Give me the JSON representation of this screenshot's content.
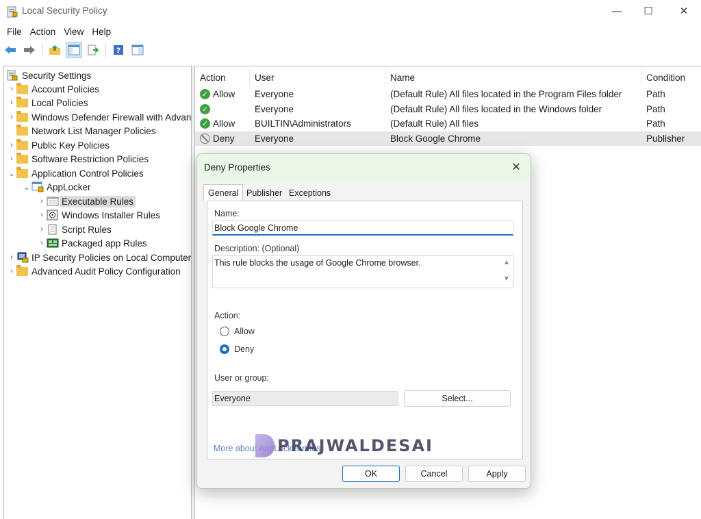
{
  "window": {
    "title": "Local Security Policy",
    "minimize": "—",
    "maximize": "☐",
    "close": "✕"
  },
  "menu": [
    "File",
    "Action",
    "View",
    "Help"
  ],
  "tree": {
    "root": "Security Settings",
    "items": [
      {
        "label": "Account Policies"
      },
      {
        "label": "Local Policies"
      },
      {
        "label": "Windows Defender Firewall with Advan"
      },
      {
        "label": "Network List Manager Policies"
      },
      {
        "label": "Public Key Policies"
      },
      {
        "label": "Software Restriction Policies"
      },
      {
        "label": "Application Control Policies"
      },
      {
        "label": "AppLocker"
      },
      {
        "label": "Executable Rules"
      },
      {
        "label": "Windows Installer Rules"
      },
      {
        "label": "Script Rules"
      },
      {
        "label": "Packaged app Rules"
      },
      {
        "label": "IP Security Policies on Local Computer"
      },
      {
        "label": "Advanced Audit Policy Configuration"
      }
    ]
  },
  "list": {
    "columns": [
      "Action",
      "User",
      "Name",
      "Condition"
    ],
    "rows": [
      {
        "action": "Allow",
        "user": "Everyone",
        "name": "(Default Rule) All files located in the Program Files folder",
        "condition": "Path"
      },
      {
        "action": "",
        "user": "Everyone",
        "name": "(Default Rule) All files located in the Windows folder",
        "condition": "Path"
      },
      {
        "action": "Allow",
        "user": "BUILTIN\\Administrators",
        "name": "(Default Rule) All files",
        "condition": "Path"
      },
      {
        "action": "Deny",
        "user": "Everyone",
        "name": "Block Google Chrome",
        "condition": "Publisher"
      }
    ]
  },
  "dialog": {
    "title": "Deny Properties",
    "tabs": [
      "General",
      "Publisher",
      "Exceptions"
    ],
    "name_label": "Name:",
    "name_value": "Block Google Chrome",
    "description_label": "Description: (Optional)",
    "description_value": "This rule blocks the usage of Google Chrome browser.",
    "action_label": "Action:",
    "allow_label": "Allow",
    "deny_label": "Deny",
    "selected_action": "Deny",
    "user_group_label": "User or group:",
    "user_group_value": "Everyone",
    "select_button": "Select...",
    "more_link": "More about AppLocker rules",
    "ok": "OK",
    "cancel": "Cancel",
    "apply": "Apply"
  },
  "watermark": "PRAJWALDESAI"
}
